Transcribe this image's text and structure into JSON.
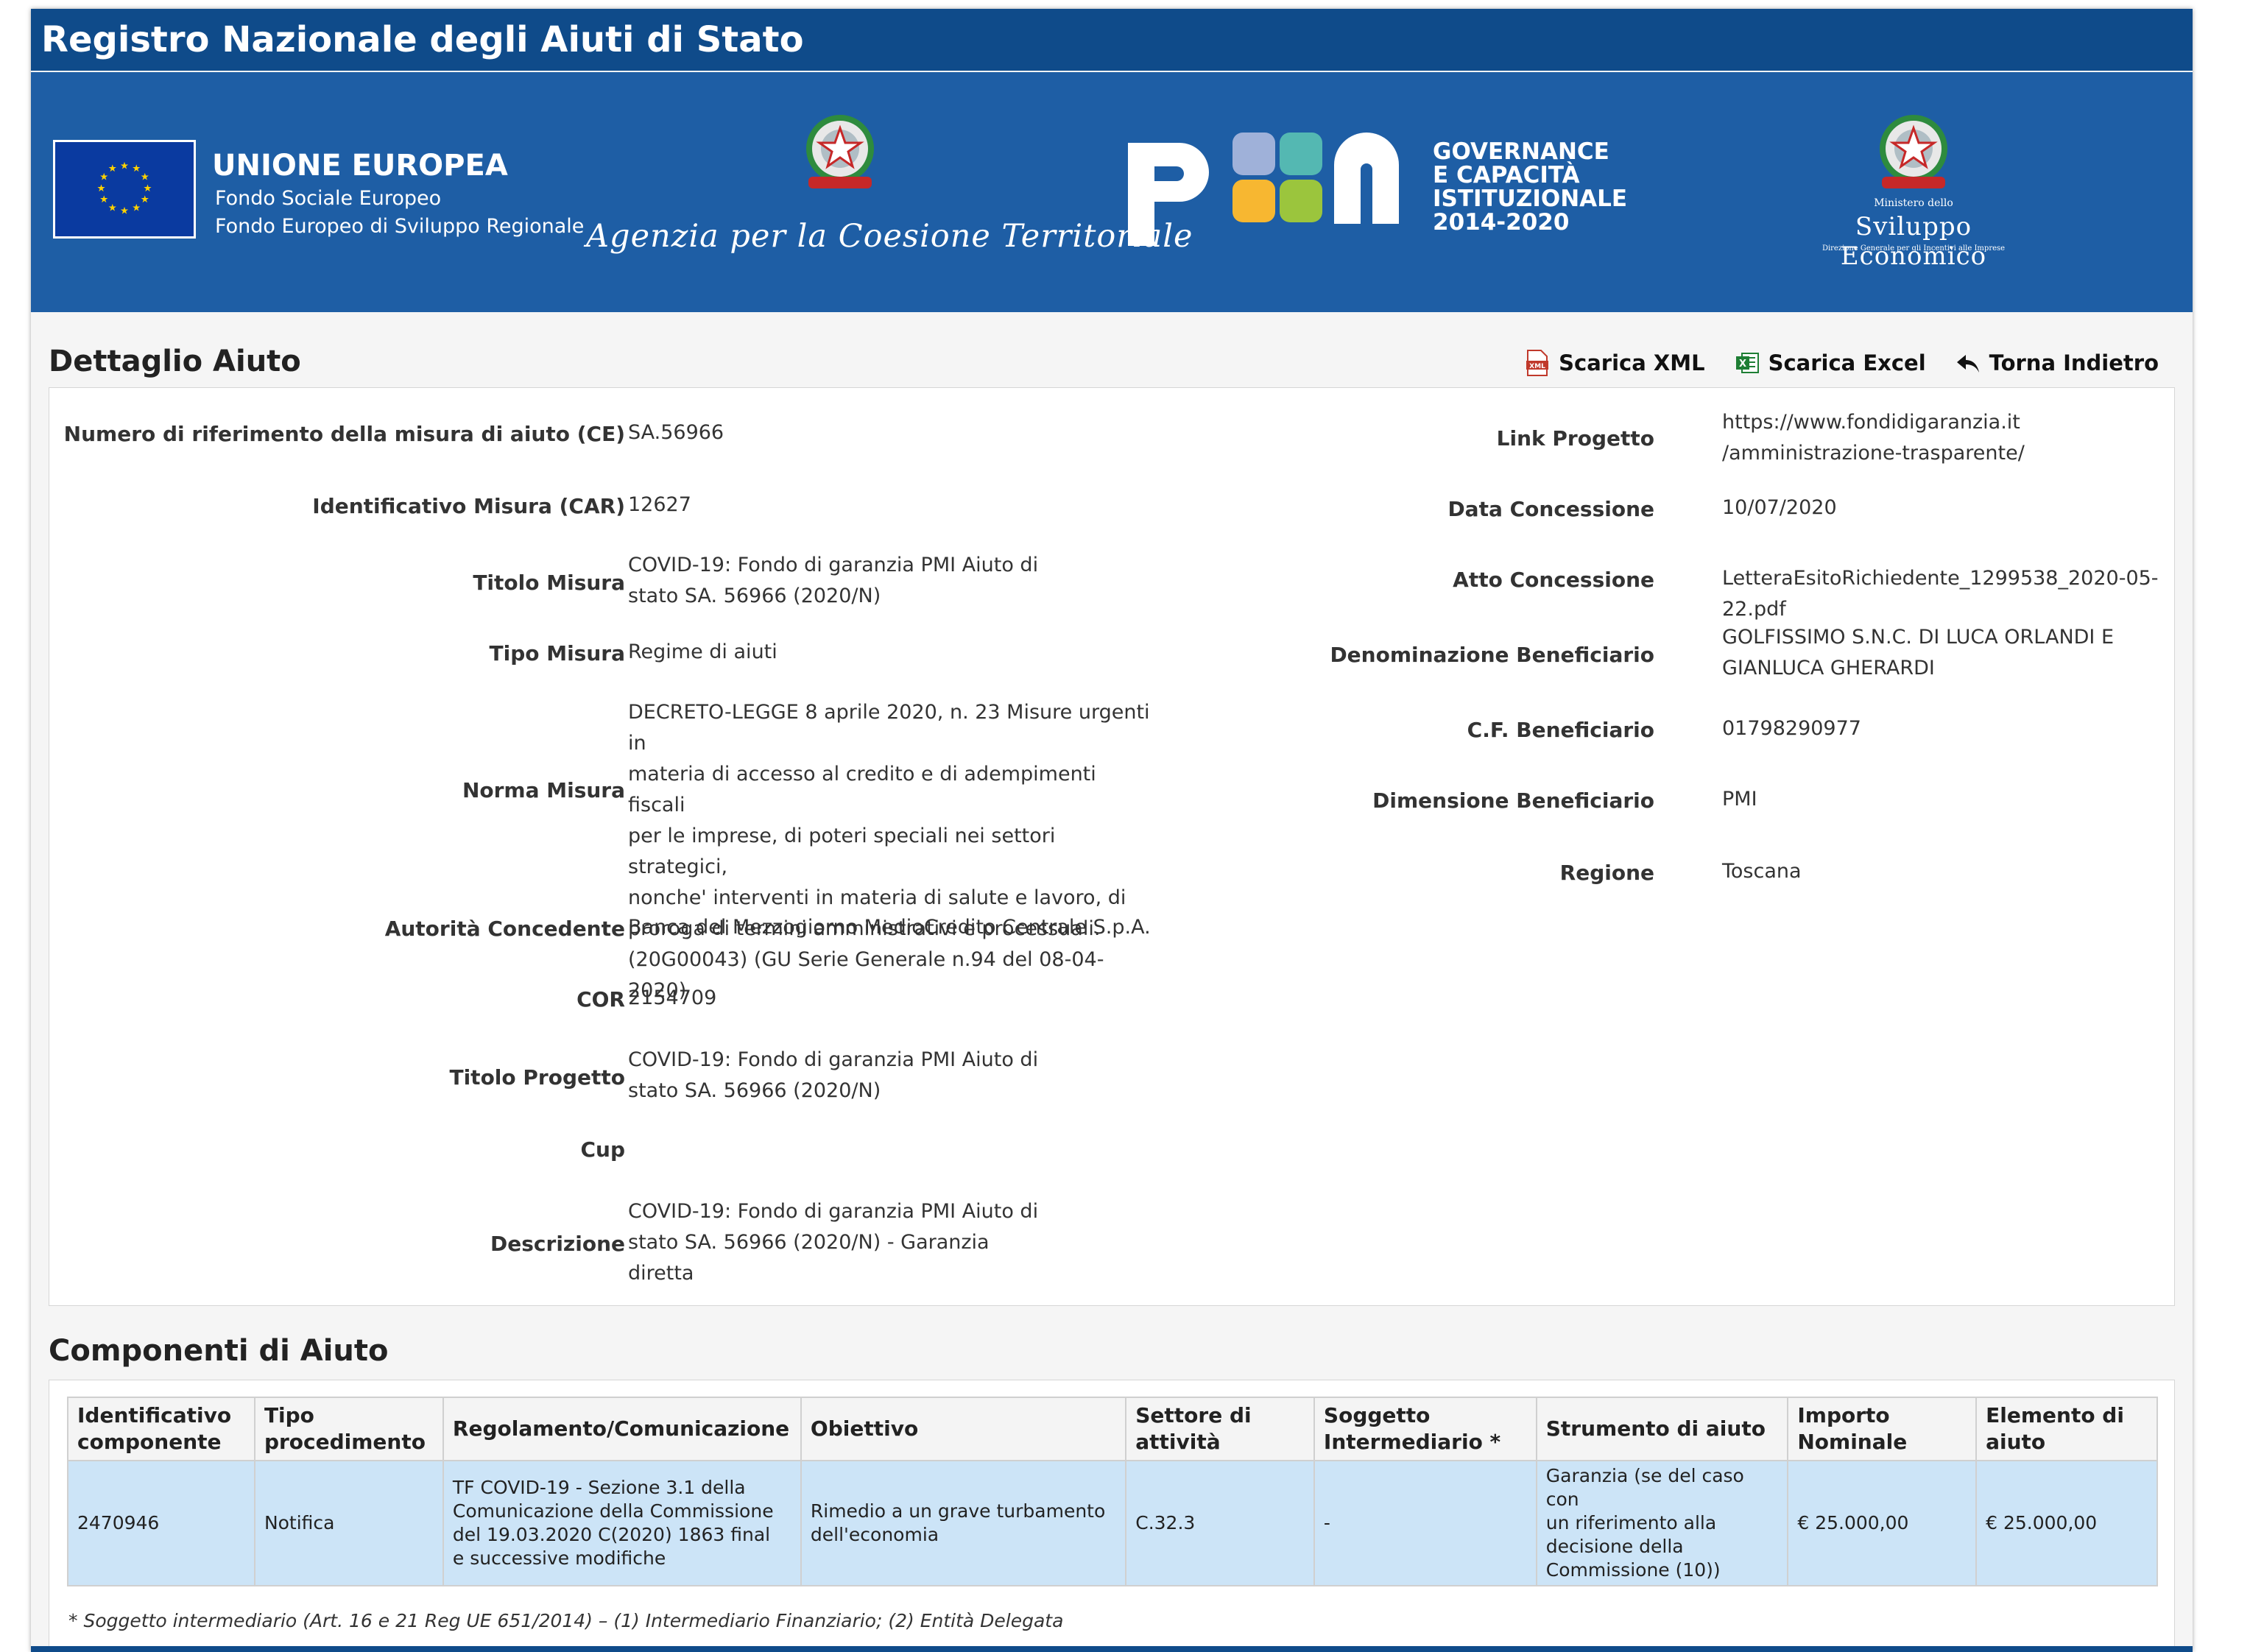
{
  "header": {
    "title": "Registro Nazionale degli Aiuti di Stato"
  },
  "banner": {
    "eu_title": "UNIONE EUROPEA",
    "eu_line1": "Fondo Sociale Europeo",
    "eu_line2": "Fondo Europeo di Sviluppo Regionale",
    "agency": "Agenzia per la Coesione Territoriale",
    "pon_lines": [
      "GOVERNANCE",
      "E CAPACITÀ",
      "ISTITUZIONALE",
      "2014-2020"
    ],
    "mise_small": "Ministero dello",
    "mise_big": "Sviluppo Economico",
    "mise_sub": "Direzione Generale per gli Incentivi alle Imprese"
  },
  "detail": {
    "section_title": "Dettaglio Aiuto",
    "toolbar": {
      "xml": "Scarica XML",
      "excel": "Scarica Excel",
      "back": "Torna Indietro"
    },
    "left": [
      {
        "label": "Numero di riferimento della misura di aiuto (CE)",
        "value": "SA.56966"
      },
      {
        "label": "Identificativo Misura (CAR)",
        "value": "12627"
      },
      {
        "label": "Titolo Misura",
        "value": "COVID-19: Fondo di garanzia PMI Aiuto di\nstato SA. 56966 (2020/N)"
      },
      {
        "label": "Tipo Misura",
        "value": "Regime di aiuti"
      },
      {
        "label": "Norma Misura",
        "value": "DECRETO-LEGGE 8 aprile 2020, n. 23 Misure urgenti in\nmateria di accesso al credito e di adempimenti fiscali\nper le imprese, di poteri speciali nei settori strategici,\nnonche' interventi in materia di salute e lavoro, di\nproroga di termini amministrativi e processuali.\n(20G00043) (GU Serie Generale n.94 del 08-04-2020)"
      },
      {
        "label": "Autorità Concedente",
        "value": "Banca del Mezzogiorno MedioCredito Centrale S.p.A."
      },
      {
        "label": "COR",
        "value": "2154709"
      },
      {
        "label": "Titolo Progetto",
        "value": "COVID-19: Fondo di garanzia PMI Aiuto di\nstato SA. 56966 (2020/N)"
      },
      {
        "label": "Cup",
        "value": ""
      },
      {
        "label": "Descrizione",
        "value": "COVID-19: Fondo di garanzia PMI Aiuto di\nstato SA. 56966 (2020/N) - Garanzia\ndiretta"
      }
    ],
    "right": [
      {
        "label": "Link Progetto",
        "value": "https://www.fondidigaranzia.it\n/amministrazione-trasparente/"
      },
      {
        "label": "Data Concessione",
        "value": "10/07/2020"
      },
      {
        "label": "Atto Concessione",
        "value": "LetteraEsitoRichiedente_1299538_2020-05-22.pdf"
      },
      {
        "label": "Denominazione Beneficiario",
        "value": "GOLFISSIMO S.N.C. DI LUCA ORLANDI E\nGIANLUCA GHERARDI"
      },
      {
        "label": "C.F. Beneficiario",
        "value": "01798290977"
      },
      {
        "label": "Dimensione Beneficiario",
        "value": "PMI"
      },
      {
        "label": "Regione",
        "value": "Toscana"
      }
    ]
  },
  "components": {
    "section_title": "Componenti di Aiuto",
    "headers": [
      "Identificativo\ncomponente",
      "Tipo\nprocedimento",
      "Regolamento/Comunicazione",
      "Obiettivo",
      "Settore di\nattività",
      "Soggetto\nIntermediario *",
      "Strumento di aiuto",
      "Importo\nNominale",
      "Elemento di\naiuto"
    ],
    "rows": [
      [
        "2470946",
        "Notifica",
        "TF COVID-19 - Sezione 3.1 della\nComunicazione della Commissione\ndel 19.03.2020 C(2020) 1863 final\ne successive modifiche",
        "Rimedio a un grave turbamento\ndell'economia",
        "C.32.3",
        "-",
        "Garanzia (se del caso con\nun riferimento alla\ndecisione della\nCommissione (10))",
        "€ 25.000,00",
        "€ 25.000,00"
      ]
    ],
    "note": "* Soggetto intermediario (Art. 16 e 21 Reg UE 651/2014) – (1) Intermediario Finanziario; (2) Entità Delegata"
  },
  "colors": {
    "title_bar": "#0f4b8a",
    "banner": "#1e5ea5",
    "row_highlight": "#cce4f7"
  },
  "icons": {
    "xml": "xml-file-icon",
    "excel": "excel-file-icon",
    "back": "back-arrow-icon"
  }
}
